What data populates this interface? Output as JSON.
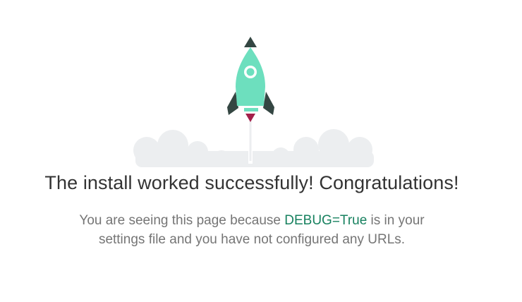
{
  "heading": {
    "title": "The install worked successfully! Congratulations!"
  },
  "message": {
    "before": "You are seeing this page because ",
    "debug_flag": "DEBUG=True",
    "after": " is in your settings file and you have not configured any URLs."
  },
  "colors": {
    "rocket_body": "#6ddfbe",
    "rocket_dark": "#344642",
    "flame": "#a3204a",
    "cloud": "#eceef0",
    "title_text": "#333333",
    "body_text": "#757575",
    "debug_accent": "#17815f"
  },
  "illustration": {
    "icon": "rocket-launch-icon"
  }
}
